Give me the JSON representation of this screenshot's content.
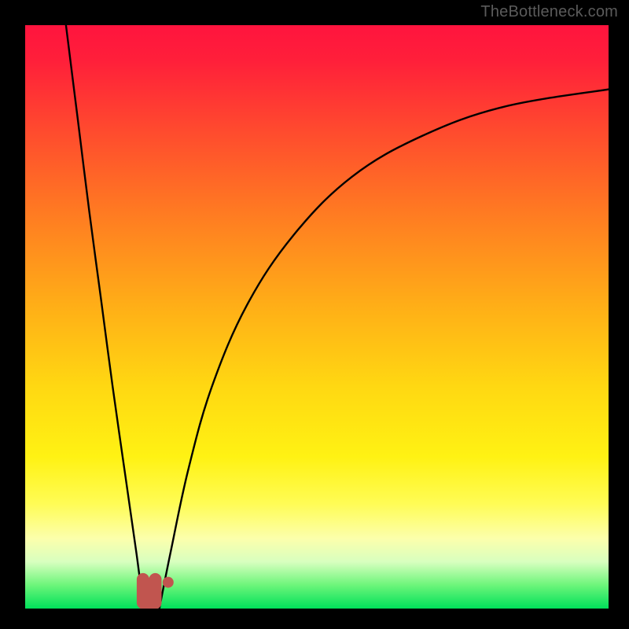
{
  "watermark": "TheBottleneck.com",
  "colors": {
    "frame": "#000000",
    "curve": "#000000",
    "marker": "#c1554f"
  },
  "chart_data": {
    "type": "line",
    "title": "",
    "xlabel": "",
    "ylabel": "",
    "xlim": [
      0,
      100
    ],
    "ylim": [
      0,
      100
    ],
    "grid": false,
    "note": "No numeric axis ticks or labels are rendered in the image; x/y values below are estimated from the plotted pixel positions within the 0–100 plot-area coordinate frame.",
    "series": [
      {
        "name": "left_curve",
        "x": [
          7,
          9,
          11,
          13,
          15,
          17,
          19,
          20,
          21
        ],
        "values": [
          100,
          84,
          68,
          53,
          38,
          24,
          10,
          3,
          0
        ]
      },
      {
        "name": "right_curve",
        "x": [
          23,
          25,
          28,
          32,
          38,
          46,
          56,
          68,
          82,
          100
        ],
        "values": [
          0,
          10,
          24,
          38,
          52,
          64,
          74,
          81,
          86,
          89
        ]
      }
    ],
    "marker": {
      "name": "U-shaped highlight",
      "vertices_x": [
        20.2,
        20.2,
        22.3,
        22.3
      ],
      "vertices_y": [
        5.0,
        1.0,
        1.0,
        5.0
      ],
      "dot": {
        "x": 24.5,
        "y": 4.5
      }
    },
    "gradient_stops": [
      {
        "pos": 0.0,
        "color": "#ff143e"
      },
      {
        "pos": 0.18,
        "color": "#ff4a2e"
      },
      {
        "pos": 0.48,
        "color": "#ffae17"
      },
      {
        "pos": 0.74,
        "color": "#fff213"
      },
      {
        "pos": 0.92,
        "color": "#d8ffbf"
      },
      {
        "pos": 1.0,
        "color": "#00e05a"
      }
    ]
  }
}
